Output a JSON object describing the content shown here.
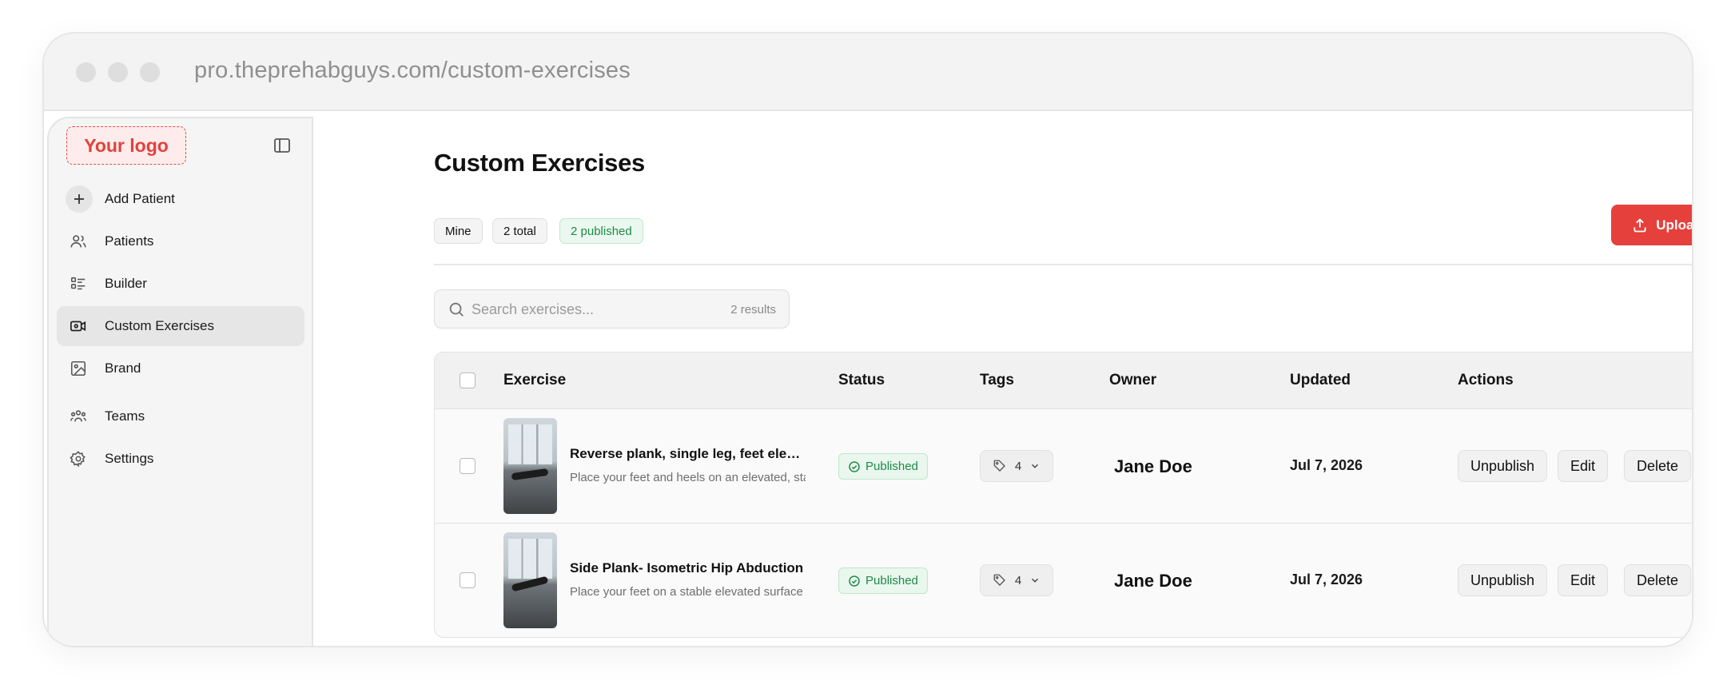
{
  "browser": {
    "url": "pro.theprehabguys.com/custom-exercises"
  },
  "sidebar": {
    "logo": "Your logo",
    "items": [
      {
        "label": "Add Patient",
        "icon": "plus-icon"
      },
      {
        "label": "Patients",
        "icon": "users-icon"
      },
      {
        "label": "Builder",
        "icon": "list-icon"
      },
      {
        "label": "Custom Exercises",
        "icon": "video-icon",
        "active": true
      },
      {
        "label": "Brand",
        "icon": "image-icon"
      },
      {
        "label": "Teams",
        "icon": "team-icon"
      },
      {
        "label": "Settings",
        "icon": "gear-icon"
      }
    ]
  },
  "main": {
    "title": "Custom Exercises",
    "chips": {
      "mine": "Mine",
      "total": "2 total",
      "published": "2 published"
    },
    "upload_label": "Upload",
    "search": {
      "placeholder": "Search exercises...",
      "results": "2 results"
    },
    "table": {
      "headers": {
        "exercise": "Exercise",
        "status": "Status",
        "tags": "Tags",
        "owner": "Owner",
        "updated": "Updated",
        "actions": "Actions"
      },
      "rows": [
        {
          "title": "Reverse plank, single leg, feet elevated",
          "description": "Place your feet and heels on an elevated, stable surface",
          "status": "Published",
          "tags": "4",
          "owner": "Jane Doe",
          "updated": "Jul 7, 2026",
          "actions": {
            "unpublish": "Unpublish",
            "edit": "Edit",
            "delete": "Delete"
          }
        },
        {
          "title": "Side Plank- Isometric Hip Abduction",
          "description": "Place your feet on a stable elevated surface",
          "status": "Published",
          "tags": "4",
          "owner": "Jane Doe",
          "updated": "Jul 7, 2026",
          "actions": {
            "unpublish": "Unpublish",
            "edit": "Edit",
            "delete": "Delete"
          }
        }
      ]
    }
  },
  "colors": {
    "accent": "#e5403b",
    "success": "#1f8a47",
    "success_bg": "#e9f7ee"
  }
}
